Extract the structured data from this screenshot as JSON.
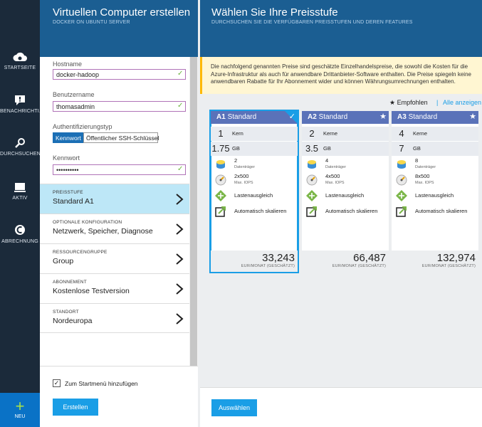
{
  "nav": {
    "items": [
      {
        "label": "STARTSEITE",
        "icon": "cloud-icon"
      },
      {
        "label": "BENACHRICHTI...",
        "icon": "notification-icon"
      },
      {
        "label": "DURCHSUCHEN",
        "icon": "browse-icon"
      },
      {
        "label": "AKTIV",
        "icon": "active-icon"
      },
      {
        "label": "ABRECHNUNG",
        "icon": "billing-icon"
      }
    ],
    "new_label": "NEU",
    "new_glyph": "+"
  },
  "blade1": {
    "title": "Virtuellen Computer erstellen",
    "subtitle": "DOCKER ON UBUNTU SERVER",
    "form": {
      "hostname_label": "Hostname",
      "hostname_value": "docker-hadoop",
      "username_label": "Benutzername",
      "username_value": "thomasadmin",
      "auth_label": "Authentifizierungstyp",
      "auth_password": "Kennwort",
      "auth_ssh": "Öffentlicher SSH-Schlüssel",
      "password_label": "Kennwort",
      "password_value": "••••••••••",
      "check_glyph": "✓"
    },
    "rows": [
      {
        "label": "PREISSTUFE",
        "value": "Standard A1"
      },
      {
        "label": "OPTIONALE KONFIGURATION",
        "value": "Netzwerk, Speicher, Diagnose"
      },
      {
        "label": "RESSOURCENGRUPPE",
        "value": "Group"
      },
      {
        "label": "ABONNEMENT",
        "value": "Kostenlose Testversion"
      },
      {
        "label": "STANDORT",
        "value": "Nordeuropa"
      }
    ],
    "startmenu_label": "Zum Startmenü hinzufügen",
    "startmenu_glyph": "✓",
    "create_button": "Erstellen"
  },
  "blade2": {
    "title": "Wählen Sie Ihre Preisstufe",
    "subtitle": "DURCHSUCHEN SIE DIE VERFÜGBAREN PREISSTUFEN UND DEREN FEATURES",
    "notice": "Die nachfolgend genannten Preise sind geschätzte Einzelhandelspreise, die sowohl die Kosten für die Azure-Infrastruktur als auch für anwendbare Drittanbieter-Software enthalten. Die Preise spiegeln keine anwendbaren Rabatte für Ihr Abonnement wider und können Währungsumrechnungen enthalten.",
    "recommended_star": "★",
    "recommended_label": "Empfohlen",
    "separator": "|",
    "all_link": "Alle anzeigen",
    "cards": [
      {
        "code": "A1",
        "name": "Standard",
        "mark": "✓",
        "cores": "1",
        "cores_unit": "Kern",
        "memory": "1.75",
        "memory_unit": "GB",
        "disks": "2",
        "disks_unit": "Datenträger",
        "iops": "2x500",
        "iops_unit": "Max. IOPS",
        "lb": "Lastenausgleich",
        "autoscale": "Automatisch skalieren",
        "price": "33,243",
        "price_unit": "EUR/MONAT (GESCHÄTZT)"
      },
      {
        "code": "A2",
        "name": "Standard",
        "mark": "★",
        "cores": "2",
        "cores_unit": "Kerne",
        "memory": "3.5",
        "memory_unit": "GB",
        "disks": "4",
        "disks_unit": "Datenträger",
        "iops": "4x500",
        "iops_unit": "Max. IOPS",
        "lb": "Lastenausgleich",
        "autoscale": "Automatisch skalieren",
        "price": "66,487",
        "price_unit": "EUR/MONAT (GESCHÄTZT)"
      },
      {
        "code": "A3",
        "name": "Standard",
        "mark": "★",
        "cores": "4",
        "cores_unit": "Kerne",
        "memory": "7",
        "memory_unit": "GB",
        "disks": "8",
        "disks_unit": "Datenträger",
        "iops": "8x500",
        "iops_unit": "Max. IOPS",
        "lb": "Lastenausgleich",
        "autoscale": "Automatisch skalieren",
        "price": "132,974",
        "price_unit": "EUR/MONAT (GESCHÄTZT)"
      }
    ],
    "select_button": "Auswählen"
  },
  "colors": {
    "header": "#1b5e92",
    "nav": "#1b2a3a",
    "accent": "#1a9ee6",
    "card_header": "#5a72b9",
    "selected_row": "#bde7f7",
    "notice_bg": "#fff6d2",
    "check_green": "#6cb33e"
  }
}
